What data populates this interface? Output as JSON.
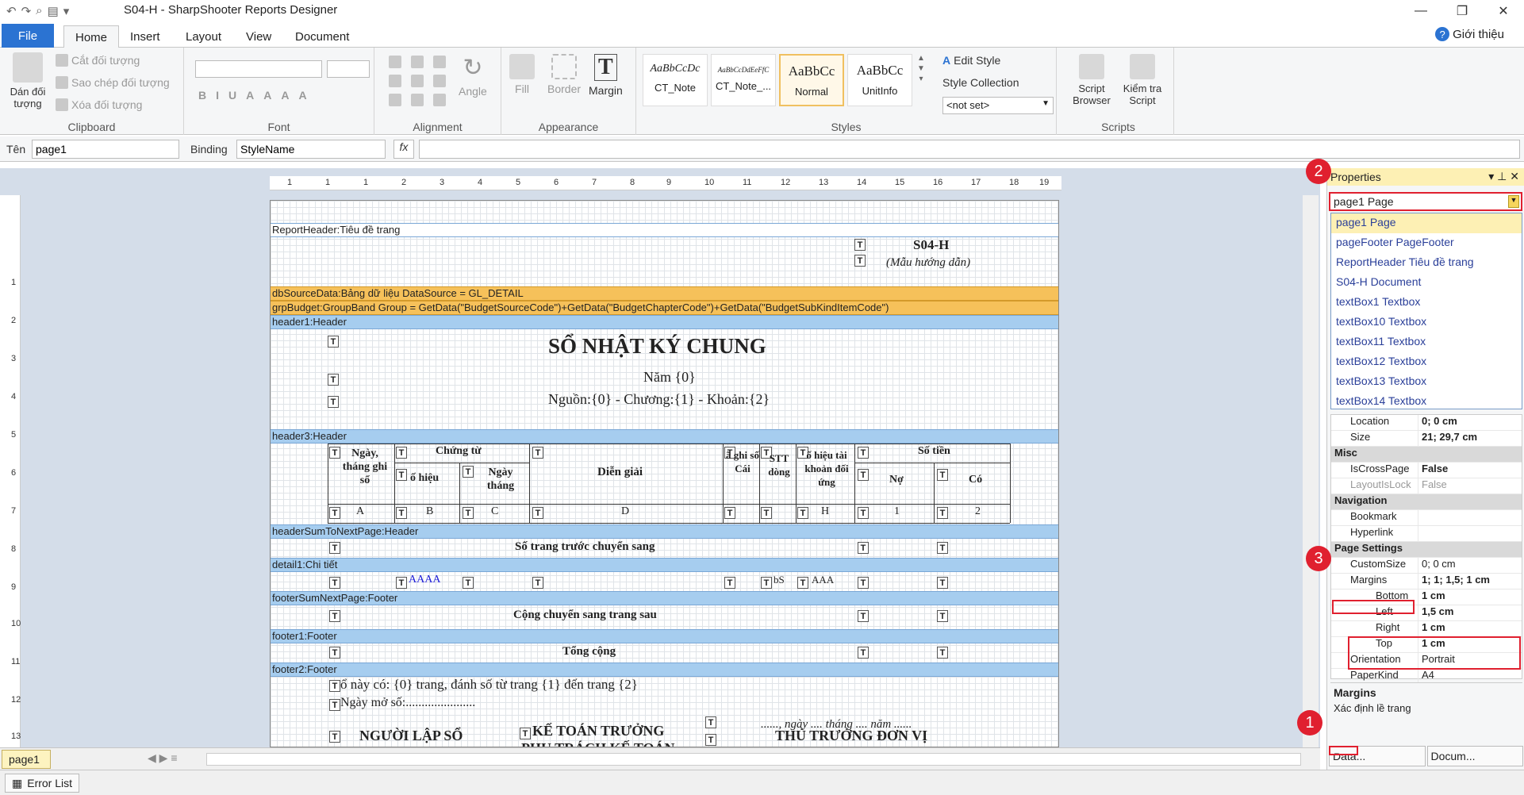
{
  "window": {
    "title": "S04-H - SharpShooter Reports Designer"
  },
  "tabs": {
    "file": "File",
    "home": "Home",
    "insert": "Insert",
    "layout": "Layout",
    "view": "View",
    "document": "Document",
    "help": "Giới thiệu"
  },
  "ribbon": {
    "clipboard": {
      "label": "Clipboard",
      "paste": "Dán đối tượng",
      "cut": "Cắt đối tượng",
      "copy": "Sao chép đối tượng",
      "delete": "Xóa đối tượng"
    },
    "font": {
      "label": "Font"
    },
    "alignment": {
      "label": "Alignment",
      "angle": "Angle"
    },
    "appearance": {
      "label": "Appearance",
      "fill": "Fill",
      "border": "Border",
      "margin": "Margin"
    },
    "styles": {
      "label": "Styles",
      "edit_style": "Edit Style",
      "style_collection": "Style Collection",
      "not_set": "<not set>",
      "items": [
        {
          "sample": "AaBbCcDc",
          "name": "CT_Note"
        },
        {
          "sample": "AaBbCcDdEeFfC",
          "name": "CT_Note_..."
        },
        {
          "sample": "AaBbCc",
          "name": "Normal"
        },
        {
          "sample": "AaBbCc",
          "name": "UnitInfo"
        }
      ]
    },
    "scripts": {
      "label": "Scripts",
      "browser": "Script Browser",
      "check": "Kiểm tra Script"
    }
  },
  "formula_bar": {
    "name_label": "Tên",
    "name_value": "page1",
    "binding_label": "Binding",
    "binding_value": "StyleName",
    "fx": "fx"
  },
  "ruler": {
    "h": [
      "1",
      "1",
      "1",
      "2",
      "3",
      "4",
      "5",
      "6",
      "7",
      "8",
      "9",
      "10",
      "11",
      "12",
      "13",
      "14",
      "15",
      "16",
      "17",
      "18",
      "19"
    ],
    "v": [
      "1",
      "2",
      "3",
      "4",
      "5",
      "6",
      "7",
      "8",
      "9",
      "10",
      "11",
      "12",
      "13"
    ]
  },
  "report": {
    "bands": {
      "report_header": "ReportHeader:Tiêu đề trang",
      "db_source": "dbSourceData:Bảng dữ liệu DataSource = GL_DETAIL",
      "grp_budget": "grpBudget:GroupBand Group = GetData(\"BudgetSourceCode\")+GetData(\"BudgetChapterCode\")+GetData(\"BudgetSubKindItemCode\")",
      "header1": "header1:Header",
      "header3": "header3:Header",
      "header_sum": "headerSumToNextPage:Header",
      "detail1": "detail1:Chi tiết",
      "footer_sum": "footerSumNextPage:Footer",
      "footer1": "footer1:Footer",
      "footer2": "footer2:Footer"
    },
    "form_code": "S04-H",
    "form_note": "(Mẫu hướng dẫn)",
    "title": "SỔ NHẬT KÝ CHUNG",
    "year": "Năm {0}",
    "source": "Nguồn:{0} - Chương:{1} - Khoản:{2}",
    "cols": {
      "ngay": "Ngày, tháng ghi sổ",
      "chung_tu": "Chứng từ",
      "so_hieu": "ố hiệu",
      "ngay_thang": "Ngày tháng",
      "dien_giai": "Diễn giải",
      "ghi_so_cai": "ã ghi số Cái",
      "stt_dong": "STT dòng",
      "so_hieu_tk": "ố hiệu tài khoản đối ứng",
      "so_tien": "Số tiền",
      "no": "Nợ",
      "co": "Có"
    },
    "col_codes": [
      "A",
      "B",
      "C",
      "D",
      "",
      "",
      "H",
      "1",
      "2"
    ],
    "prev_page": "Số trang trước chuyển sang",
    "detail_sample": "AAAA",
    "detail_bs": "bS",
    "detail_aaa": "AAA",
    "carry": "Cộng chuyển sang trang sau",
    "total": "Tổng cộng",
    "footer_pages": "ổ này có: {0} trang, đánh số từ trang {1} đến trang {2}",
    "footer_open": "Ngày mở số:......................",
    "date_line": "......, ngày .... tháng .... năm ......",
    "preparer": "NGƯỜI LẬP SỔ",
    "chief_acc": "KẾ TOÁN TRƯỞNG",
    "chief_acc2": "PHỤ TRÁCH KẾ TOÁN",
    "head": "THỦ TRƯỞNG ĐƠN VỊ"
  },
  "page_tab": "page1",
  "error_list": "Error List",
  "properties": {
    "title": "Properties",
    "object": "page1 Page",
    "dropdown": [
      "page1 Page",
      "pageFooter PageFooter",
      "ReportHeader Tiêu đề trang",
      "S04-H Document",
      "textBox1 Textbox",
      "textBox10 Textbox",
      "textBox11 Textbox",
      "textBox12 Textbox",
      "textBox13 Textbox",
      "textBox14 Textbox"
    ],
    "rows": {
      "location_k": "Location",
      "location_v": "0; 0 cm",
      "size_k": "Size",
      "size_v": "21; 29,7 cm",
      "misc": "Misc",
      "iscross_k": "IsCrossPage",
      "iscross_v": "False",
      "layoutlock_k": "LayoutIsLock",
      "layoutlock_v": "False",
      "navigation": "Navigation",
      "bookmark": "Bookmark",
      "hyperlink": "Hyperlink",
      "page_settings": "Page Settings",
      "custom_k": "CustomSize",
      "custom_v": "0; 0 cm",
      "margins_k": "Margins",
      "margins_v": "1; 1; 1,5; 1 cm",
      "bottom_k": "Bottom",
      "bottom_v": "1 cm",
      "left_k": "Left",
      "left_v": "1,5 cm",
      "right_k": "Right",
      "right_v": "1 cm",
      "top_k": "Top",
      "top_v": "1 cm",
      "orient_k": "Orientation",
      "orient_v": "Portrait",
      "paper_k": "PaperKind",
      "paper_v": "A4"
    },
    "desc_title": "Margins",
    "desc_text": "Xác định lề trang",
    "bottom_tabs": [
      "Pr...",
      "Data...",
      "Docum..."
    ]
  },
  "badges": [
    "1",
    "2",
    "3"
  ]
}
